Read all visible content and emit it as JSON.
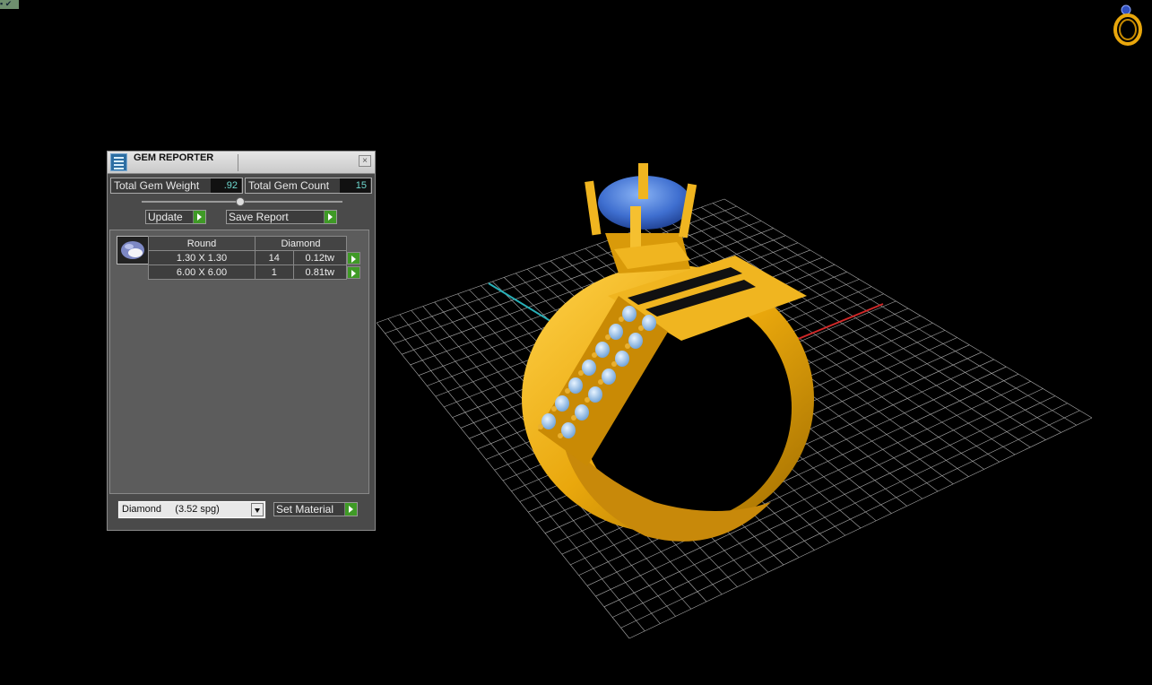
{
  "gem_reporter": {
    "title": "GEM REPORTER",
    "close_glyph": "×",
    "total_weight_label": "Total Gem Weight",
    "total_weight_value": ".92",
    "total_count_label": "Total Gem Count",
    "total_count_value": "15",
    "update_label": "Update",
    "save_report_label": "Save Report",
    "table": {
      "shape": "Round",
      "stone": "Diamond",
      "rows": [
        {
          "size": "1.30 X 1.30",
          "count": "14",
          "weight": "0.12tw"
        },
        {
          "size": "6.00 X 6.00",
          "count": "1",
          "weight": "0.81tw"
        }
      ]
    },
    "material_selected": "Diamond     (3.52 spg)",
    "set_material_label": "Set Material"
  },
  "viewport": {
    "background": "#000000",
    "metal_color": "#e9a70c",
    "center_stone_color": "#3f6fd0",
    "side_stone_color": "#a9cdf2",
    "axis_x_color": "#d02828",
    "axis_y_color": "#28b0b8",
    "grid_color": "#c8c8c8"
  },
  "icons": {
    "titlebar": "gem-reporter-icon",
    "nav_cube": "ring-nav-icon",
    "gem_shape": "round-gem-icon",
    "go": "green-arrow-icon"
  }
}
